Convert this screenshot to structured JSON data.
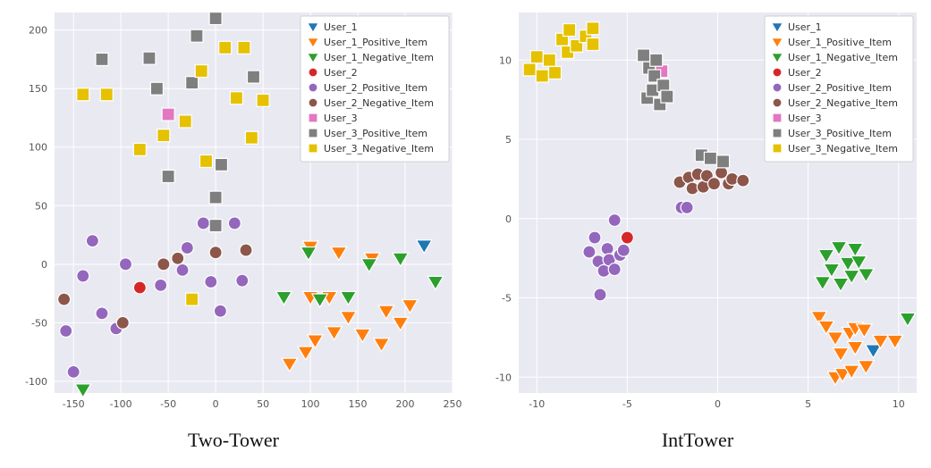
{
  "captions": {
    "left": "Two-Tower",
    "right": "IntTower"
  },
  "chart_data": [
    {
      "title": "",
      "type": "scatter",
      "xlim": [
        -170,
        250
      ],
      "ylim": [
        -110,
        215
      ],
      "xticks": [
        -150,
        -100,
        -50,
        0,
        50,
        100,
        150,
        200,
        250
      ],
      "yticks": [
        -100,
        -50,
        0,
        50,
        100,
        150,
        200
      ],
      "legend_position": "upper right",
      "series": [
        {
          "name": "User_1",
          "color": "#1f77b4",
          "marker": "triangle_down",
          "points": [
            [
              220,
              16
            ]
          ]
        },
        {
          "name": "User_1_Positive_Item",
          "color": "#ff7f0e",
          "marker": "triangle_down",
          "points": [
            [
              78,
              -85
            ],
            [
              95,
              -75
            ],
            [
              100,
              -28
            ],
            [
              105,
              -65
            ],
            [
              120,
              -28
            ],
            [
              125,
              -58
            ],
            [
              140,
              -45
            ],
            [
              155,
              -60
            ],
            [
              175,
              -68
            ],
            [
              180,
              -40
            ],
            [
              195,
              -50
            ],
            [
              205,
              -35
            ],
            [
              130,
              10
            ],
            [
              165,
              5
            ],
            [
              100,
              15
            ]
          ]
        },
        {
          "name": "User_1_Negative_Item",
          "color": "#2ca02c",
          "marker": "triangle_down",
          "points": [
            [
              -140,
              -107
            ],
            [
              72,
              -28
            ],
            [
              98,
              10
            ],
            [
              110,
              -30
            ],
            [
              140,
              -28
            ],
            [
              162,
              0
            ],
            [
              195,
              5
            ],
            [
              232,
              -15
            ]
          ]
        },
        {
          "name": "User_2",
          "color": "#d62728",
          "marker": "circle",
          "points": [
            [
              -80,
              -20
            ]
          ]
        },
        {
          "name": "User_2_Positive_Item",
          "color": "#9467bd",
          "marker": "circle",
          "points": [
            [
              -158,
              -57
            ],
            [
              -150,
              -92
            ],
            [
              -140,
              -10
            ],
            [
              -130,
              20
            ],
            [
              -120,
              -42
            ],
            [
              -105,
              -55
            ],
            [
              -95,
              0
            ],
            [
              -58,
              -18
            ],
            [
              -35,
              -5
            ],
            [
              -30,
              14
            ],
            [
              -13,
              35
            ],
            [
              -5,
              -15
            ],
            [
              5,
              -40
            ],
            [
              20,
              35
            ],
            [
              28,
              -14
            ]
          ]
        },
        {
          "name": "User_2_Negative_Item",
          "color": "#8c564b",
          "marker": "circle",
          "points": [
            [
              -160,
              -30
            ],
            [
              -98,
              -50
            ],
            [
              -55,
              0
            ],
            [
              -40,
              5
            ],
            [
              0,
              10
            ],
            [
              32,
              12
            ]
          ]
        },
        {
          "name": "User_3",
          "color": "#e377c2",
          "marker": "square",
          "points": [
            [
              -50,
              128
            ]
          ]
        },
        {
          "name": "User_3_Positive_Item",
          "color": "#7f7f7f",
          "marker": "square",
          "points": [
            [
              -120,
              175
            ],
            [
              -70,
              176
            ],
            [
              -62,
              150
            ],
            [
              -50,
              75
            ],
            [
              -25,
              155
            ],
            [
              -20,
              195
            ],
            [
              0,
              210
            ],
            [
              0,
              33
            ],
            [
              0,
              57
            ],
            [
              6,
              85
            ],
            [
              40,
              160
            ]
          ]
        },
        {
          "name": "User_3_Negative_Item",
          "color": "#e5c100",
          "marker": "square",
          "points": [
            [
              -140,
              145
            ],
            [
              -115,
              145
            ],
            [
              -80,
              98
            ],
            [
              -55,
              110
            ],
            [
              -32,
              122
            ],
            [
              -25,
              -30
            ],
            [
              -15,
              165
            ],
            [
              -10,
              88
            ],
            [
              10,
              185
            ],
            [
              22,
              142
            ],
            [
              30,
              185
            ],
            [
              38,
              108
            ],
            [
              50,
              140
            ]
          ]
        }
      ]
    },
    {
      "title": "",
      "type": "scatter",
      "xlim": [
        -11,
        11
      ],
      "ylim": [
        -11,
        13
      ],
      "xticks": [
        -10,
        -5,
        0,
        5,
        10
      ],
      "yticks": [
        -10,
        -5,
        0,
        5,
        10
      ],
      "legend_position": "upper right",
      "series": [
        {
          "name": "User_1",
          "color": "#1f77b4",
          "marker": "triangle_down",
          "points": [
            [
              8.6,
              -8.3
            ]
          ]
        },
        {
          "name": "User_1_Positive_Item",
          "color": "#ff7f0e",
          "marker": "triangle_down",
          "points": [
            [
              5.6,
              -6.2
            ],
            [
              6.0,
              -6.8
            ],
            [
              6.5,
              -7.5
            ],
            [
              6.5,
              -10.0
            ],
            [
              6.8,
              -8.5
            ],
            [
              6.9,
              -9.8
            ],
            [
              7.3,
              -7.2
            ],
            [
              7.4,
              -9.6
            ],
            [
              7.6,
              -6.9
            ],
            [
              7.6,
              -8.1
            ],
            [
              8.1,
              -7.0
            ],
            [
              8.2,
              -9.3
            ],
            [
              9.0,
              -7.7
            ],
            [
              9.8,
              -7.7
            ]
          ]
        },
        {
          "name": "User_1_Negative_Item",
          "color": "#2ca02c",
          "marker": "triangle_down",
          "points": [
            [
              5.8,
              -4.0
            ],
            [
              6.0,
              -2.3
            ],
            [
              6.3,
              -3.2
            ],
            [
              6.7,
              -1.8
            ],
            [
              6.8,
              -4.1
            ],
            [
              7.2,
              -2.8
            ],
            [
              7.4,
              -3.6
            ],
            [
              7.6,
              -1.9
            ],
            [
              7.8,
              -2.7
            ],
            [
              8.2,
              -3.5
            ],
            [
              10.5,
              -6.3
            ]
          ]
        },
        {
          "name": "User_2",
          "color": "#d62728",
          "marker": "circle",
          "points": [
            [
              -5.0,
              -1.2
            ]
          ]
        },
        {
          "name": "User_2_Positive_Item",
          "color": "#9467bd",
          "marker": "circle",
          "points": [
            [
              -7.1,
              -2.1
            ],
            [
              -6.8,
              -1.2
            ],
            [
              -6.6,
              -2.7
            ],
            [
              -6.5,
              -4.8
            ],
            [
              -6.3,
              -3.3
            ],
            [
              -6.1,
              -1.9
            ],
            [
              -6.0,
              -2.6
            ],
            [
              -5.7,
              -3.2
            ],
            [
              -5.7,
              -0.1
            ],
            [
              -5.4,
              -2.3
            ],
            [
              -5.2,
              -2.0
            ],
            [
              -2.0,
              0.7
            ],
            [
              -1.7,
              0.7
            ]
          ]
        },
        {
          "name": "User_2_Negative_Item",
          "color": "#8c564b",
          "marker": "circle",
          "points": [
            [
              -2.1,
              2.3
            ],
            [
              -1.6,
              2.6
            ],
            [
              -1.4,
              1.9
            ],
            [
              -1.1,
              2.8
            ],
            [
              -0.8,
              2.0
            ],
            [
              -0.6,
              2.7
            ],
            [
              -0.2,
              2.2
            ],
            [
              0.2,
              2.9
            ],
            [
              0.6,
              2.2
            ],
            [
              0.8,
              2.5
            ],
            [
              1.4,
              2.4
            ]
          ]
        },
        {
          "name": "User_3",
          "color": "#e377c2",
          "marker": "square",
          "points": [
            [
              -3.1,
              9.3
            ]
          ]
        },
        {
          "name": "User_3_Positive_Item",
          "color": "#7f7f7f",
          "marker": "square",
          "points": [
            [
              -4.1,
              10.3
            ],
            [
              -3.9,
              7.6
            ],
            [
              -3.8,
              9.5
            ],
            [
              -3.6,
              8.1
            ],
            [
              -3.5,
              9.0
            ],
            [
              -3.4,
              10.0
            ],
            [
              -3.2,
              7.2
            ],
            [
              -3.0,
              8.4
            ],
            [
              -2.8,
              7.7
            ],
            [
              -0.9,
              4.0
            ],
            [
              -0.4,
              3.8
            ],
            [
              0.3,
              3.6
            ]
          ]
        },
        {
          "name": "User_3_Negative_Item",
          "color": "#e5c100",
          "marker": "square",
          "points": [
            [
              -10.4,
              9.4
            ],
            [
              -10.0,
              10.2
            ],
            [
              -9.7,
              9.0
            ],
            [
              -9.3,
              10.0
            ],
            [
              -9.0,
              9.2
            ],
            [
              -8.6,
              11.3
            ],
            [
              -8.3,
              10.5
            ],
            [
              -8.2,
              11.9
            ],
            [
              -7.8,
              10.9
            ],
            [
              -7.3,
              11.5
            ],
            [
              -6.9,
              12.0
            ],
            [
              -6.9,
              11.0
            ]
          ]
        }
      ]
    }
  ]
}
